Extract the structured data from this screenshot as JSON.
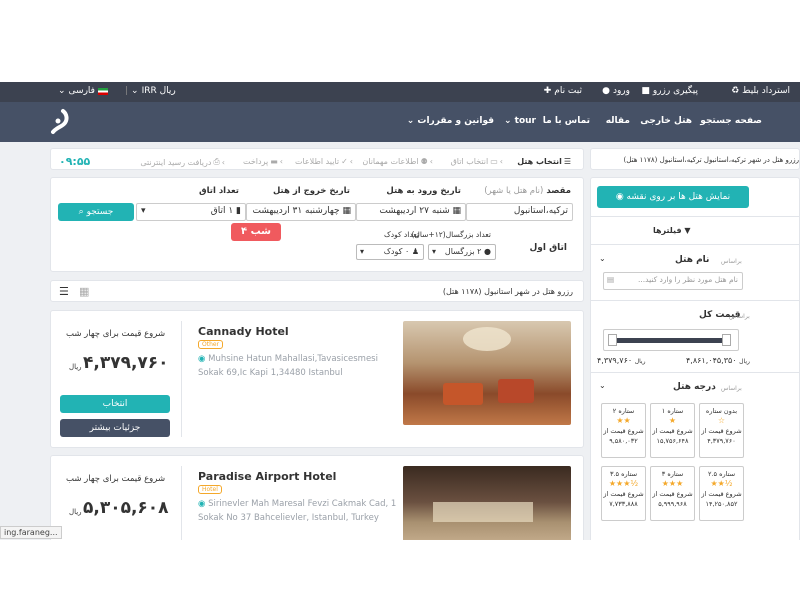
{
  "topbar": {
    "refund": "استرداد بلیط",
    "track": "پیگیری رزرو",
    "login": "ورود",
    "register": "ثبت نام",
    "currency": "IRR ریال",
    "language": "فارسی"
  },
  "nav": {
    "home": "صفحه جستجو",
    "foreign_hotel": "هتل خارجی",
    "article": "مقاله",
    "contact": "تماس با ما",
    "tour": "tour",
    "rules": "قوانین و مقررات"
  },
  "steps": {
    "select_hotel": "انتخاب هتل",
    "select_room": "انتخاب اتاق",
    "guests_info": "اطلاعات مهمانان",
    "confirm_info": "تایید اطلاعات",
    "payment": "پرداخت",
    "receipt": "دریافت رسید اینترنتی",
    "timer": "۰۹:۵۵"
  },
  "breadcrumb": "رزرو هتل در شهر ترکیه،استانبول ترکیه،استانبول (۱۱۷۸ هتل)",
  "search": {
    "destination_label": "مقصد",
    "destination_hint": "(نام هتل یا شهر)",
    "destination_value": "ترکیه،استانبول",
    "checkin_label": "تاریخ ورود به هتل",
    "checkin_value": "شنبه ۲۷ اردیبهشت",
    "checkout_label": "تاریخ خروج از هتل",
    "checkout_value": "چهارشنبه ۳۱ اردیبهشت",
    "rooms_label": "تعداد اتاق",
    "rooms_value": "۱ اتاق",
    "search_button": "جستجو",
    "nights": "۴ شب",
    "room_first": "اتاق اول",
    "adults_label": "تعداد بزرگسال",
    "adults_hint": "(۱۲+سال)",
    "adults_value": "۲ بزرگسال",
    "children_label": "تعداد کودک",
    "children_value": "۰ کودک"
  },
  "results_header": "رزرو هتل در شهر استانبول (۱۱۷۸ هتل)",
  "hotels": [
    {
      "name": "Cannady Hotel",
      "badge": "Other",
      "address": "Muhsine Hatun Mahallasi,Tavasicesmesi Sokak 69,Ic Kapi 1,34480 Istanbul",
      "price_label": "شروع قیمت برای چهار شب",
      "price": "۴,۳۷۹,۷۶۰",
      "currency": "ریال",
      "select": "انتخاب",
      "details": "جزئیات بیشتر"
    },
    {
      "name": "Paradise Airport Hotel",
      "badge": "Hotel",
      "address": "Sirinevler Mah Maresal Fevzi Cakmak Cad, 1 Sokak No 37 Bahcelievler, Istanbul, Turkey",
      "price_label": "شروع قیمت برای چهار شب",
      "price": "۵,۳۰۵,۶۰۸",
      "currency": "ریال"
    }
  ],
  "sidebar": {
    "map_button": "نمایش هتل ها بر روی نقشه",
    "filters": "فیلترها",
    "hotel_name_title": "نام هتل",
    "hotel_name_sub": "براساس",
    "hotel_name_placeholder": "نام هتل مورد نظر را وارد کنید...",
    "price_title": "قیمت کل",
    "price_sub": "براساس",
    "price_min": "۴,۳۷۹,۷۶۰",
    "price_max": "۴,۸۶۱,۰۴۵,۳۵۰",
    "stars_title": "درجه هتل",
    "stars_sub": "براساس",
    "star_boxes": [
      {
        "title": "بدون ستاره",
        "from": "شروع قیمت از",
        "price": "۴,۳۷۹,۷۶۰",
        "stars": "☆"
      },
      {
        "title": "۱ ستاره",
        "from": "شروع قیمت از",
        "price": "۱۵,۷۵۶,۶۴۸",
        "stars": "★"
      },
      {
        "title": "۲ ستاره",
        "from": "شروع قیمت از",
        "price": "۹,۵۸۰,۰۳۲",
        "stars": "★★"
      },
      {
        "title": "۲.۵ ستاره",
        "from": "شروع قیمت از",
        "price": "۱۴,۲۵۰,۸۵۲",
        "stars": "★★½"
      },
      {
        "title": "۳ ستاره",
        "from": "شروع قیمت از",
        "price": "۵,۹۹۹,۹۶۸",
        "stars": "★★★"
      },
      {
        "title": "۳.۵ ستاره",
        "from": "شروع قیمت از",
        "price": "۷,۷۳۳,۸۸۸",
        "stars": "★★★½"
      }
    ]
  },
  "status_bar": "ing.faraneg..."
}
